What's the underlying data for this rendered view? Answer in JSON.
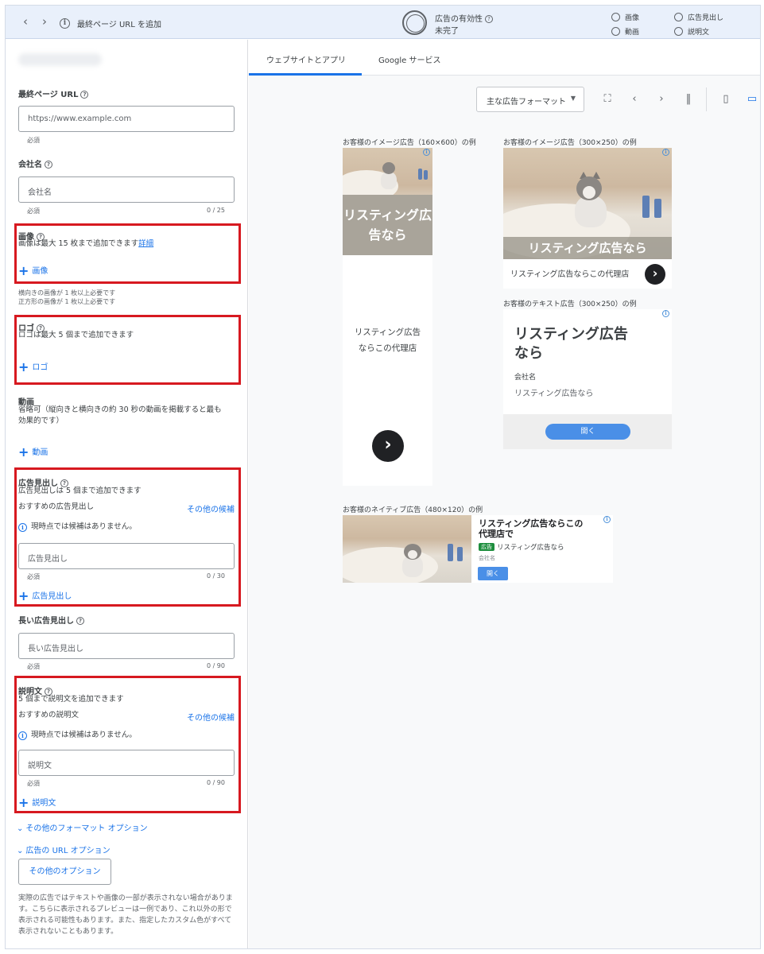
{
  "topbar": {
    "title": "最終ページ URL を追加",
    "effectiveness_label": "広告の有効性",
    "effectiveness_status": "未完了",
    "checklist": [
      "画像",
      "広告見出し",
      "動画",
      "説明文"
    ]
  },
  "left": {
    "final_url": {
      "label": "最終ページ URL",
      "placeholder": "https://www.example.com",
      "hint": "必須"
    },
    "company": {
      "label": "会社名",
      "placeholder": "会社名",
      "hint": "必須",
      "counter": "0 / 25"
    },
    "images": {
      "label": "画像",
      "desc": "画像は最大 15 枚まで追加できます",
      "detail_link": "詳細",
      "add": "画像",
      "note1": "横向きの画像が 1 枚以上必要です",
      "note2": "正方形の画像が 1 枚以上必要です"
    },
    "logo": {
      "label": "ロゴ",
      "desc": "ロゴは最大 5 個まで追加できます",
      "add": "ロゴ"
    },
    "video": {
      "label": "動画",
      "desc1": "省略可（縦向きと横向きの約 30 秒の動画を掲載すると最も",
      "desc2": "効果的です）",
      "add": "動画"
    },
    "headline": {
      "label": "広告見出し",
      "desc": "広告見出しは 5 個まで追加できます",
      "rec": "おすすめの広告見出し",
      "more": "その他の候補",
      "info": "現時点では候補はありません。",
      "placeholder": "広告見出し",
      "hint": "必須",
      "counter": "0 / 30",
      "add": "広告見出し"
    },
    "long_headline": {
      "label": "長い広告見出し",
      "placeholder": "長い広告見出し",
      "hint": "必須",
      "counter": "0 / 90"
    },
    "description": {
      "label": "説明文",
      "desc": "5 個まで説明文を追加できます",
      "rec": "おすすめの説明文",
      "more": "その他の候補",
      "info": "現時点では候補はありません。",
      "placeholder": "説明文",
      "hint": "必須",
      "counter": "0 / 90",
      "add": "説明文"
    },
    "more_formats": "その他のフォーマット オプション",
    "url_options": "広告の URL オプション",
    "other_options_button": "その他のオプション",
    "disclaimer": "実際の広告ではテキストや画像の一部が表示されない場合があります。こちらに表示されるプレビューは一例であり、これ以外の形で表示される可能性もあります。また、指定したカスタム色がすべて表示されないこともあります。"
  },
  "right": {
    "tabs": [
      "ウェブサイトとアプリ",
      "Google サービス"
    ],
    "format_select": "主な広告フォーマット",
    "ads": {
      "tall": {
        "caption": "お客様のイメージ広告（160×600）の例",
        "overlay": "リスティング広告なら",
        "body1": "リスティング広告",
        "body2": "ならこの代理店"
      },
      "square": {
        "caption": "お客様のイメージ広告（300×250）の例",
        "overlay": "リスティング広告なら",
        "body": "リスティング広告ならこの代理店"
      },
      "text": {
        "caption": "お客様のテキスト広告（300×250）の例",
        "title1": "リスティング広告",
        "title2": "なら",
        "company": "会社名",
        "body": "リスティング広告なら",
        "button": "開く"
      },
      "native": {
        "caption": "お客様のネイティブ広告（480×120）の例",
        "title1": "リスティング広告ならこの",
        "title2": "代理店で",
        "badge": "広告",
        "body": "リスティング広告なら",
        "company": "会社名",
        "button": "開く"
      }
    }
  }
}
